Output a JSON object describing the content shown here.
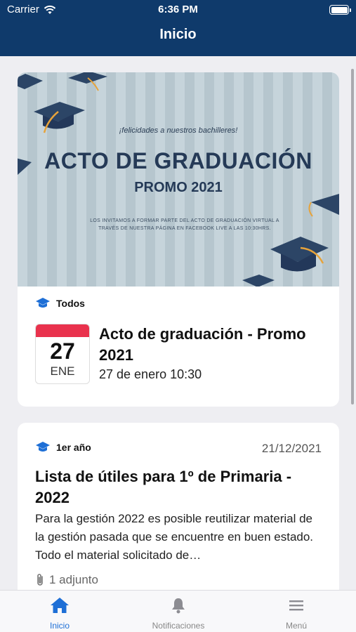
{
  "status_bar": {
    "carrier": "Carrier",
    "time": "6:36 PM"
  },
  "header": {
    "title": "Inicio"
  },
  "cards": [
    {
      "banner": {
        "tagline": "¡felicidades a nuestros bachilleres!",
        "title": "ACTO DE GRADUACIÓN",
        "subtitle": "PROMO 2021",
        "text": "LOS INVITAMOS A FORMAR PARTE DEL ACTO DE GRADUACIÓN VIRTUAL A TRAVÉS DE NUESTRA PÁGINA EN FACEBOOK LIVE A LAS 10:30HRS."
      },
      "audience": "Todos",
      "calendar": {
        "day": "27",
        "month": "ENE"
      },
      "title": "Acto de graduación - Promo 2021",
      "datetime": "27 de enero 10:30"
    },
    {
      "audience": "1er año",
      "date": "21/12/2021",
      "title": "Lista de útiles para 1º de Primaria - 2022",
      "body": "Para la gestión 2022 es posible reutilizar material de la gestión pasada que se encuentre en buen estado. Todo el material solicitado de…",
      "attachments": "1 adjunto"
    }
  ],
  "tabbar": {
    "items": [
      {
        "label": "Inicio",
        "icon": "home-icon",
        "active": true
      },
      {
        "label": "Notificaciones",
        "icon": "bell-icon",
        "active": false
      },
      {
        "label": "Menú",
        "icon": "menu-icon",
        "active": false
      }
    ]
  },
  "colors": {
    "header": "#0f3a6b",
    "accent": "#1e6fd6",
    "calendar_top": "#e9324d"
  }
}
